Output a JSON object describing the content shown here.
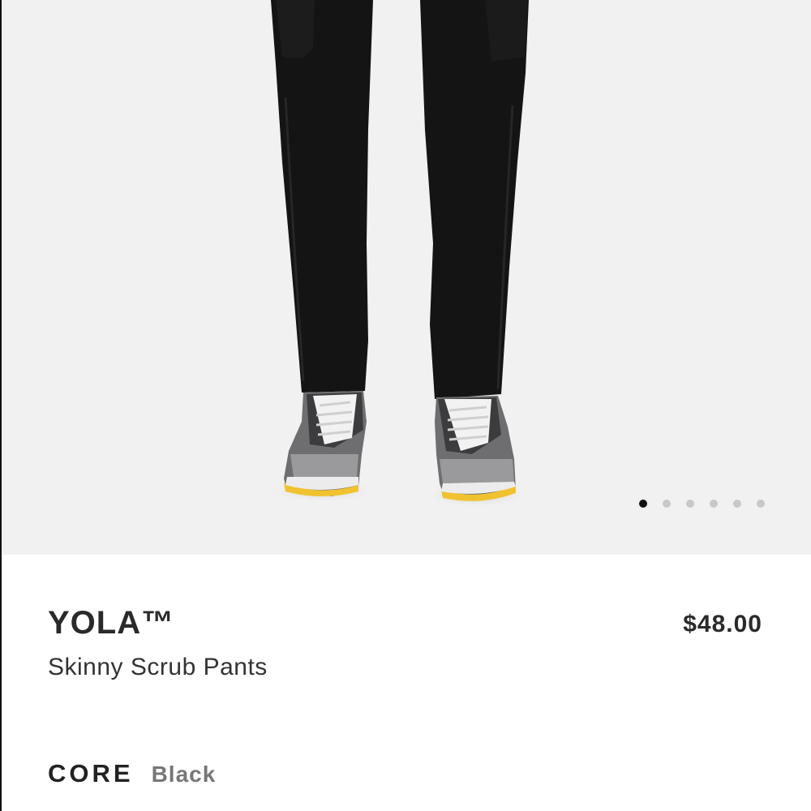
{
  "product": {
    "name": "YOLA™",
    "subtitle": "Skinny Scrub Pants",
    "price": "$48.00",
    "collection": "CORE",
    "color": "Black"
  },
  "gallery": {
    "slide_count": 6,
    "active_slide": 1
  }
}
